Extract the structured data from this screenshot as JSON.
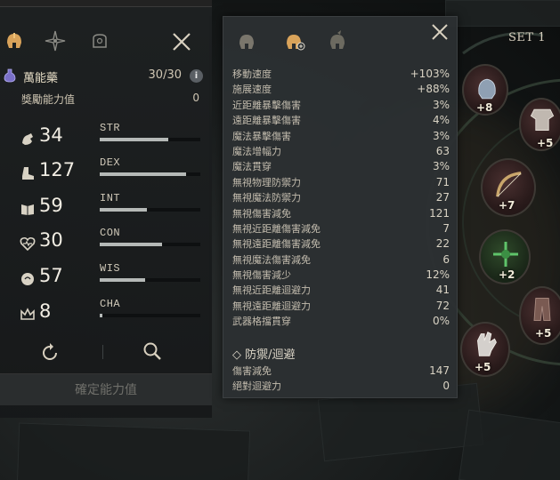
{
  "left_panel": {
    "tabs": [
      {
        "icon": "helmet-icon"
      },
      {
        "icon": "compass-star-icon"
      },
      {
        "icon": "bag-icon"
      }
    ],
    "potion": {
      "label": "萬能藥",
      "count": "30/30",
      "info": "i"
    },
    "bonus": {
      "label": "獎勵能力值",
      "value": "0"
    },
    "stats": [
      {
        "value": "34",
        "name": "STR",
        "icon": "arm-icon",
        "fill": 0.68
      },
      {
        "value": "127",
        "name": "DEX",
        "icon": "boot-icon",
        "fill": 0.86
      },
      {
        "value": "59",
        "name": "INT",
        "icon": "book-icon",
        "fill": 0.47
      },
      {
        "value": "30",
        "name": "CON",
        "icon": "heart-icon",
        "fill": 0.62
      },
      {
        "value": "57",
        "name": "WIS",
        "icon": "mind-icon",
        "fill": 0.45
      },
      {
        "value": "8",
        "name": "CHA",
        "icon": "crown-icon",
        "fill": 0.03
      }
    ],
    "confirm_label": "確定能力值"
  },
  "detail_panel": {
    "rows": [
      {
        "name": "移動速度",
        "value": "+103%"
      },
      {
        "name": "施展速度",
        "value": "+88%"
      },
      {
        "name": "近距離暴擊傷害",
        "value": "3%"
      },
      {
        "name": "遠距離暴擊傷害",
        "value": "4%"
      },
      {
        "name": "魔法暴擊傷害",
        "value": "3%"
      },
      {
        "name": "魔法增幅力",
        "value": "63"
      },
      {
        "name": "魔法貫穿",
        "value": "3%"
      },
      {
        "name": "無視物理防禦力",
        "value": "71"
      },
      {
        "name": "無視魔法防禦力",
        "value": "27"
      },
      {
        "name": "無視傷害減免",
        "value": "121"
      },
      {
        "name": "無視近距離傷害減免",
        "value": "7"
      },
      {
        "name": "無視遠距離傷害減免",
        "value": "22"
      },
      {
        "name": "無視魔法傷害減免",
        "value": "6"
      },
      {
        "name": "無視傷害減少",
        "value": "12%"
      },
      {
        "name": "無視近距離迴避力",
        "value": "41"
      },
      {
        "name": "無視遠距離迴避力",
        "value": "72"
      },
      {
        "name": "武器格擋貫穿",
        "value": "0%"
      }
    ],
    "section_title": "◇ 防禦/迴避",
    "section_rows": [
      {
        "name": "傷害減免",
        "value": "147"
      },
      {
        "name": "絕對迴避力",
        "value": "0"
      }
    ]
  },
  "equipment": {
    "set_label": "SET 1",
    "items": [
      {
        "plus": "+8"
      },
      {
        "plus": "+5"
      },
      {
        "plus": "+7"
      },
      {
        "plus": "+2"
      },
      {
        "plus": "+5"
      },
      {
        "plus": "+5"
      }
    ]
  }
}
